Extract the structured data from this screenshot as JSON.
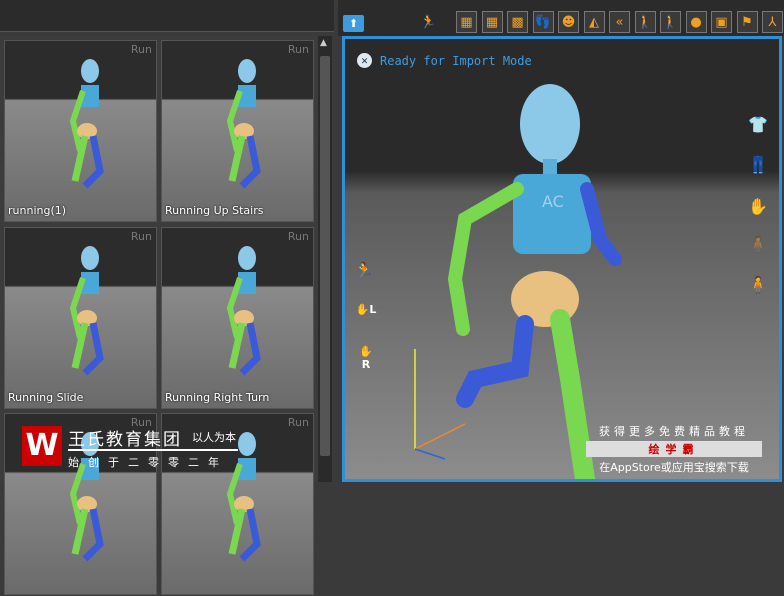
{
  "library": {
    "items": [
      {
        "name": "running(1)",
        "tag": "Run"
      },
      {
        "name": "Running Up Stairs",
        "tag": "Run"
      },
      {
        "name": "Running Slide",
        "tag": "Run"
      },
      {
        "name": "Running Right Turn",
        "tag": "Run"
      },
      {
        "name": "",
        "tag": "Run"
      },
      {
        "name": "",
        "tag": "Run"
      }
    ]
  },
  "toolbar": {
    "icons": [
      "grid-icon",
      "grid-fill-icon",
      "checker-floor-icon",
      "foot-icon",
      "head-icon",
      "mirror-icon",
      "rewind-icon",
      "walk-on-spot-icon",
      "walk-forward-icon",
      "ball-icon",
      "camera-frame-icon",
      "flag-icon",
      "axis-icon"
    ]
  },
  "viewport": {
    "status": "Ready for Import Mode",
    "left_labels": [
      "L",
      "R"
    ],
    "label_3d": "AC"
  },
  "watermark": {
    "brand": "王氏教育集团",
    "motto": "以人为本",
    "since": "始创于二零零二年",
    "promo1": "获得更多免费精品教程",
    "promo_brand": "绘学霸",
    "promo2": "在AppStore或应用宝搜索下载"
  },
  "colors": {
    "accent": "#2e90d8",
    "icon": "#f0a020"
  }
}
